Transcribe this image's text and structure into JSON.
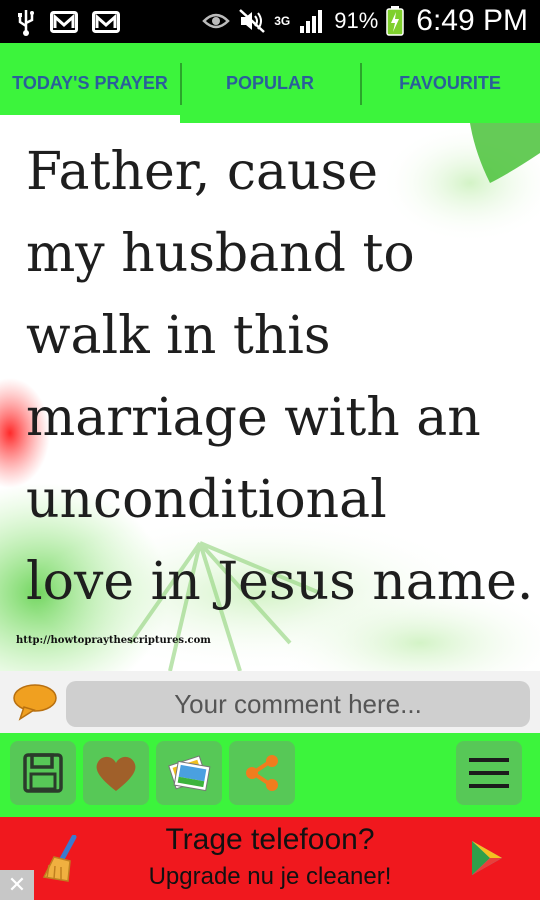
{
  "status_bar": {
    "network": "3G",
    "battery": "91%",
    "time": "6:49 PM",
    "icons": [
      "usb-icon",
      "mail-icon",
      "mail-icon",
      "eye-icon",
      "mute-icon",
      "signal-icon",
      "battery-icon"
    ]
  },
  "tabs": [
    {
      "label": "TODAY'S PRAYER",
      "selected": true
    },
    {
      "label": "POPULAR",
      "selected": false
    },
    {
      "label": "FAVOURITE",
      "selected": false
    }
  ],
  "prayer": {
    "lines": [
      "Father, cause",
      "my husband to",
      "walk in this",
      "marriage with an",
      "unconditional",
      "love in Jesus name."
    ],
    "source": "http://howtopraythescriptures.com"
  },
  "comment": {
    "placeholder": "Your comment here...",
    "value": ""
  },
  "actions": {
    "icons": [
      "save-icon",
      "heart-icon",
      "images-icon",
      "share-icon",
      "menu-icon"
    ]
  },
  "ad": {
    "line1": "Trage telefoon?",
    "line2": "Upgrade nu je cleaner!",
    "close": "✕"
  },
  "colors": {
    "accent_green": "#3cf43c",
    "tab_text": "#2a5f9a",
    "ad_red": "#f0181e",
    "share_orange": "#f07d1e",
    "heart_brown": "#a0602a"
  }
}
